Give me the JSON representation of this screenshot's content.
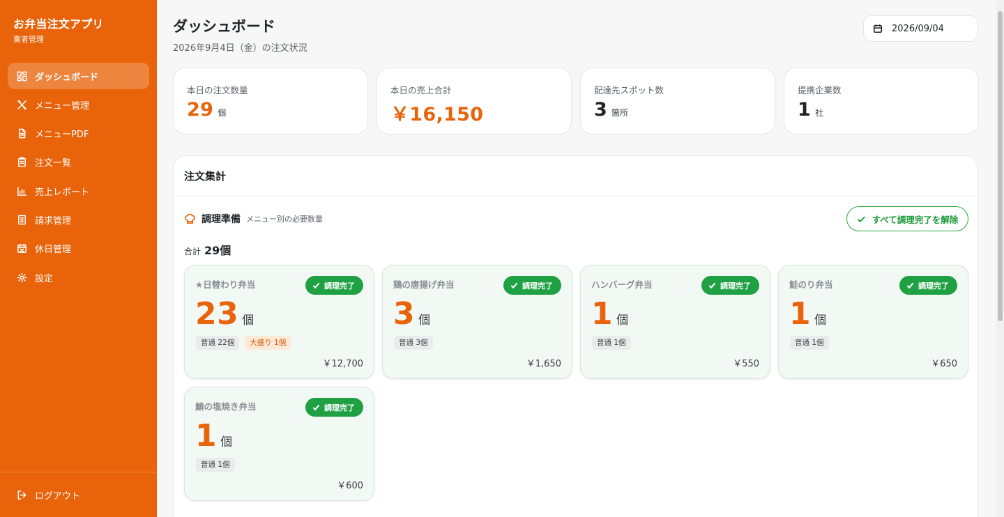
{
  "app": {
    "title": "お弁当注文アプリ",
    "subtitle": "業者管理",
    "accent_color": "#e8630a",
    "success_color": "#1ea043"
  },
  "sidebar": {
    "items": [
      {
        "label": "ダッシュボード",
        "icon": "dashboard-icon",
        "active": true
      },
      {
        "label": "メニュー管理",
        "icon": "utensils-icon",
        "active": false
      },
      {
        "label": "メニューPDF",
        "icon": "file-icon",
        "active": false
      },
      {
        "label": "注文一覧",
        "icon": "clipboard-icon",
        "active": false
      },
      {
        "label": "売上レポート",
        "icon": "bar-chart-icon",
        "active": false
      },
      {
        "label": "請求管理",
        "icon": "invoice-icon",
        "active": false
      },
      {
        "label": "休日管理",
        "icon": "calendar-off-icon",
        "active": false
      },
      {
        "label": "設定",
        "icon": "gear-icon",
        "active": false
      }
    ],
    "logout_label": "ログアウト"
  },
  "header": {
    "title": "ダッシュボード",
    "subtitle": "2026年9月4日（金）の注文状況",
    "date_value": "2026/09/04"
  },
  "stats": [
    {
      "label": "本日の注文数量",
      "value": "29",
      "unit": "個",
      "highlight": true
    },
    {
      "label": "本日の売上合計",
      "value": "￥16,150",
      "unit": "",
      "highlight": true
    },
    {
      "label": "配達先スポット数",
      "value": "3",
      "unit": "箇所",
      "highlight": false
    },
    {
      "label": "提携企業数",
      "value": "1",
      "unit": "社",
      "highlight": false
    }
  ],
  "summary": {
    "title": "注文集計",
    "section_title": "調理準備",
    "section_subtitle": "メニュー別の必要数量",
    "clear_button": "すべて調理完了を解除",
    "total_label": "合計",
    "total_value": "29個",
    "done_label": "調理完了",
    "items": [
      {
        "name": "★日替わり弁当",
        "qty": "23",
        "unit": "個",
        "normal": "普通 22個",
        "large": "大盛り 1個",
        "price": "￥12,700"
      },
      {
        "name": "鶏の唐揚げ弁当",
        "qty": "3",
        "unit": "個",
        "normal": "普通 3個",
        "large": "",
        "price": "￥1,650"
      },
      {
        "name": "ハンバーグ弁当",
        "qty": "1",
        "unit": "個",
        "normal": "普通 1個",
        "large": "",
        "price": "￥550"
      },
      {
        "name": "鮭のり弁当",
        "qty": "1",
        "unit": "個",
        "normal": "普通 1個",
        "large": "",
        "price": "￥650"
      },
      {
        "name": "鯖の塩焼き弁当",
        "qty": "1",
        "unit": "個",
        "normal": "普通 1個",
        "large": "",
        "price": "￥600"
      }
    ]
  }
}
